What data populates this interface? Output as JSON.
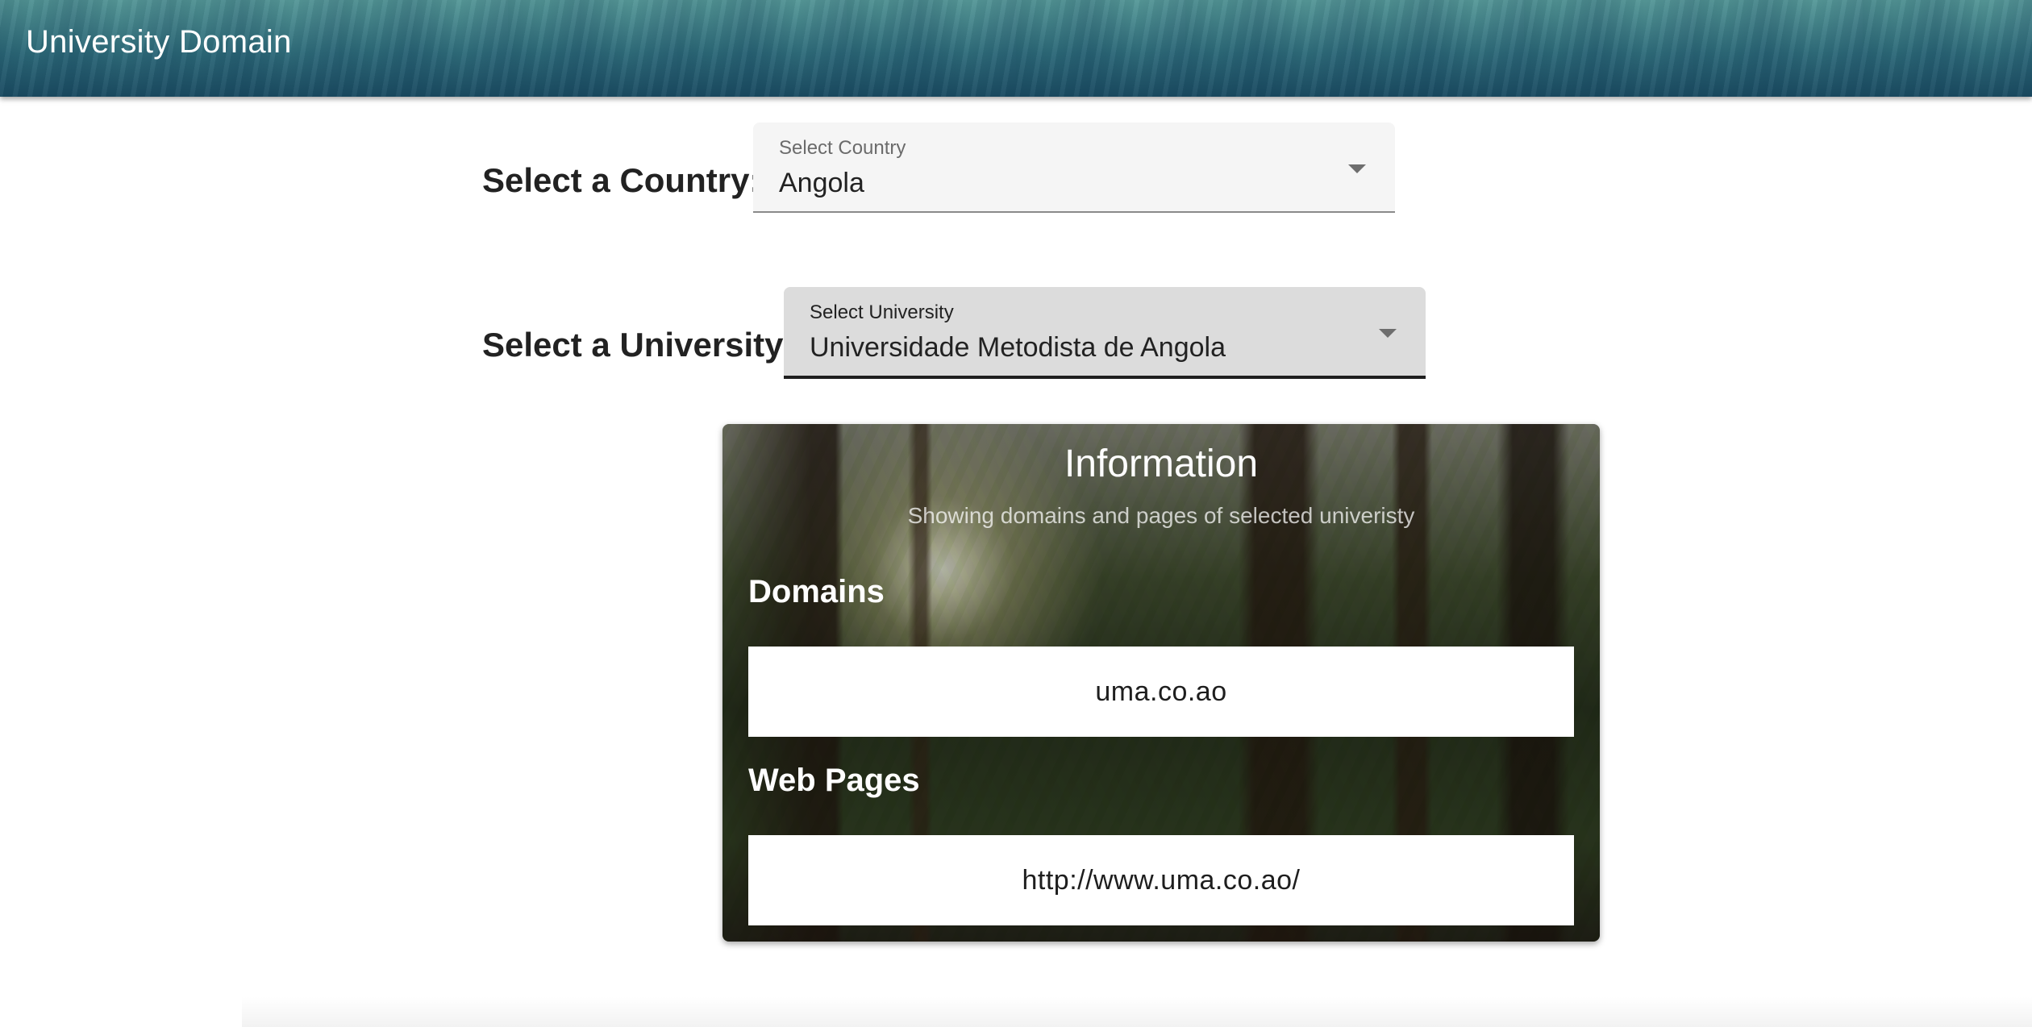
{
  "app": {
    "title": "University Domain"
  },
  "country": {
    "row_label": "Select a Country:",
    "field_label": "Select Country",
    "value": "Angola"
  },
  "university": {
    "row_label": "Select a University:",
    "field_label": "Select University",
    "value": "Universidade Metodista de Angola"
  },
  "info": {
    "title": "Information",
    "subtitle": "Showing domains and pages of selected univeristy",
    "domains_title": "Domains",
    "domain_value": "uma.co.ao",
    "webpages_title": "Web Pages",
    "webpage_value": "http://www.uma.co.ao/"
  },
  "icons": {
    "dropdown": "arrow-drop-down-icon"
  },
  "colors": {
    "appbar": "#2a6470",
    "select_bg": "#f5f5f5",
    "select_focused_bg": "#dcdcdc",
    "label_text": "#222222"
  }
}
